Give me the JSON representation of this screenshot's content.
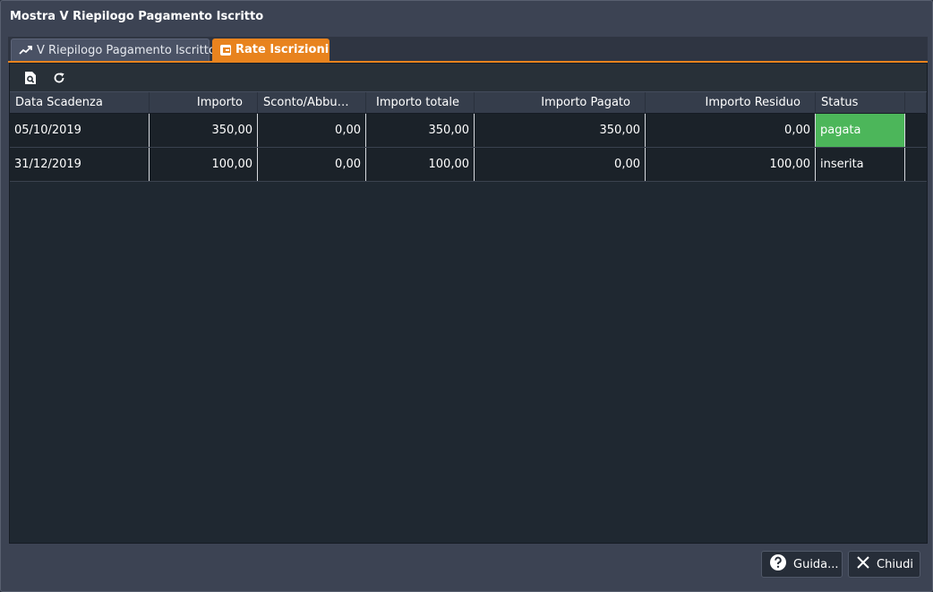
{
  "window": {
    "title": "Mostra V Riepilogo Pagamento Iscritto"
  },
  "tabs": [
    {
      "label": "V Riepilogo Pagamento Iscritto",
      "icon": "trend-line-icon",
      "active": false
    },
    {
      "label": "Rate Iscrizioni",
      "icon": "wallet-icon",
      "active": true
    }
  ],
  "toolbar": {
    "tools": [
      {
        "icon": "document-search-icon"
      },
      {
        "icon": "refresh-icon"
      }
    ]
  },
  "grid": {
    "columns": [
      "Data Scadenza",
      "Importo",
      "Sconto/Abbu…",
      "Importo totale",
      "Importo Pagato",
      "Importo Residuo",
      "Status"
    ],
    "rows": [
      {
        "data_scadenza": "05/10/2019",
        "importo": "350,00",
        "sconto": "0,00",
        "importo_totale": "350,00",
        "importo_pagato": "350,00",
        "importo_residuo": "0,00",
        "status": "pagata"
      },
      {
        "data_scadenza": "31/12/2019",
        "importo": "100,00",
        "sconto": "0,00",
        "importo_totale": "100,00",
        "importo_pagato": "0,00",
        "importo_residuo": "100,00",
        "status": "inserita"
      }
    ]
  },
  "footer": {
    "help_label": "Guida...",
    "close_label": "Chiudi"
  },
  "colors": {
    "accent": "#e8831e",
    "status_paid": "#4cb65a",
    "panel": "#1f2831",
    "window": "#3c4353"
  }
}
